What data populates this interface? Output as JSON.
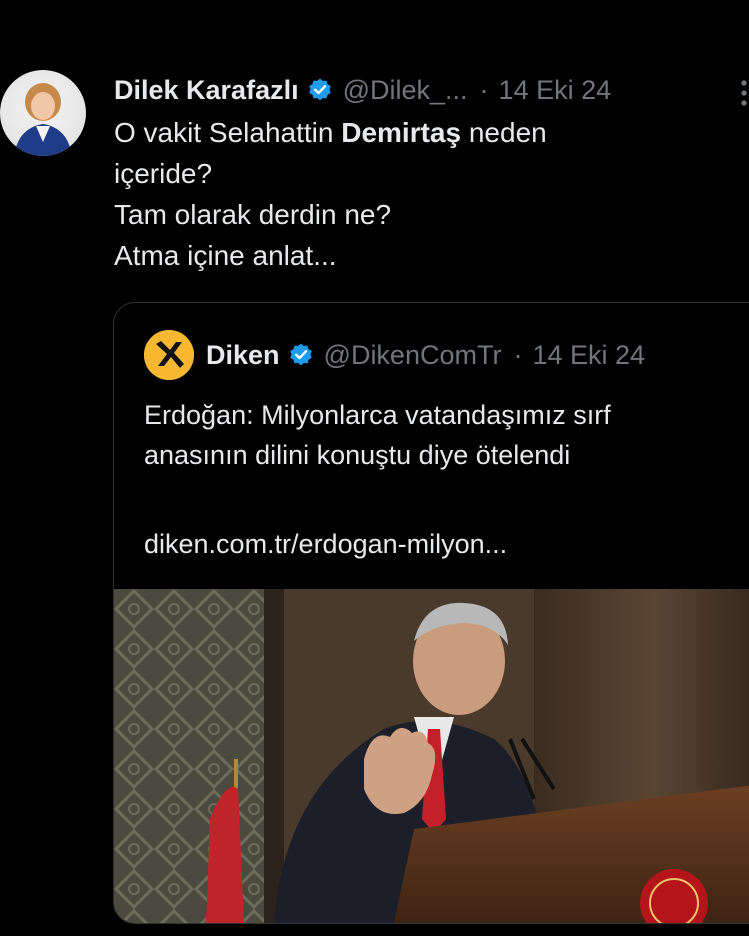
{
  "tweet": {
    "author_name": "Dilek Karafazlı",
    "handle": "@Dilek_...",
    "separator": "·",
    "date": "14 Eki 24",
    "text_line1_before": "O vakit Selahattin ",
    "text_line1_bold": "Demirtaş",
    "text_line1_after": " neden",
    "text_line2": "içeride?",
    "text_line3": "Tam olarak derdin ne?",
    "text_line4": "Atma içine anlat...",
    "verified_color": "#1d9bf0"
  },
  "quote": {
    "author_name": "Diken",
    "handle": "@DikenComTr",
    "separator": "·",
    "date": "14 Eki 24",
    "text_line1": "Erdoğan: Milyonlarca vatandaşımız sırf",
    "text_line2": "anasının dilini konuştu diye ötelendi",
    "link": "diken.com.tr/erdogan-milyon...",
    "logo_color": "#f7b731"
  },
  "icons": {
    "more": "more-vertical-icon",
    "verified": "verified-badge-icon",
    "logo": "diken-logo-icon"
  }
}
